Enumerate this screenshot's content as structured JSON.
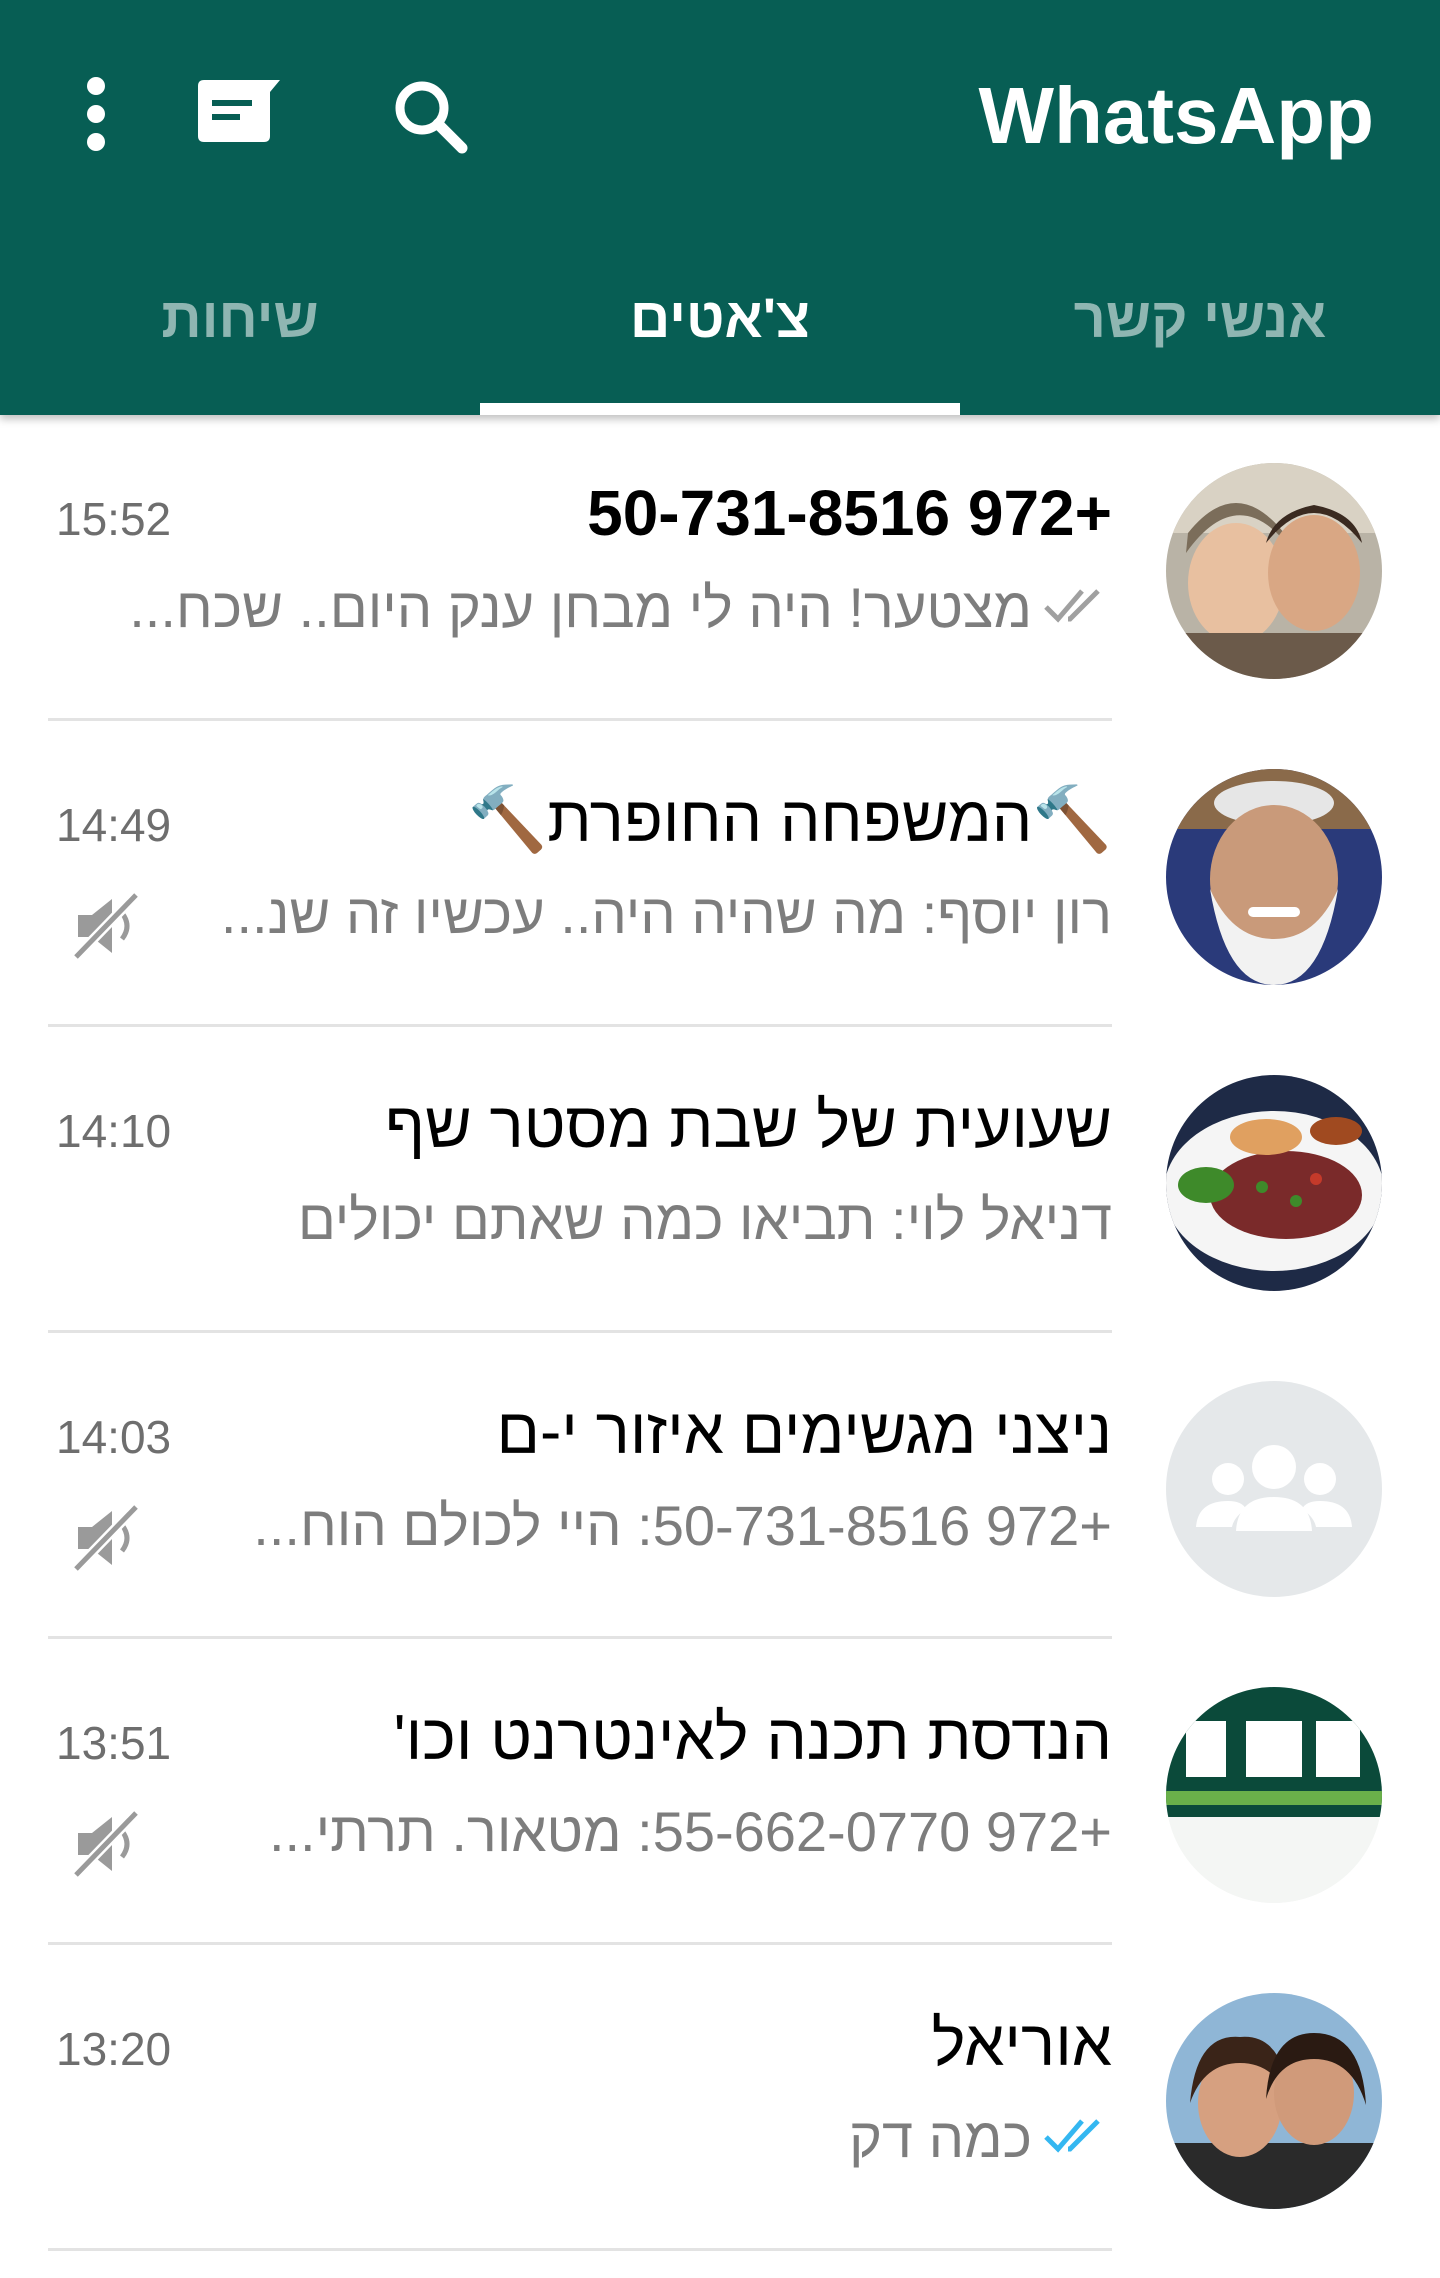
{
  "app": {
    "title": "WhatsApp",
    "colors": {
      "primary": "#075e54",
      "tick_read": "#34b7f1",
      "tick_delivered": "#a0a0a0",
      "muted_icon": "#9a9a9a"
    }
  },
  "toolbar": {
    "icons": [
      "more-vert-icon",
      "new-chat-icon",
      "search-icon"
    ]
  },
  "tabs": [
    {
      "label": "אנשי קשר",
      "active": false
    },
    {
      "label": "צ'אטים",
      "active": true
    },
    {
      "label": "שיחות",
      "active": false
    }
  ],
  "chats": [
    {
      "name": "+972 50-731-8516",
      "time": "15:52",
      "preview": "מצטער! היה לי מבחן ענק היום.. שכח...",
      "status": "delivered",
      "muted": false,
      "bold": true,
      "avatar": "couple-photo"
    },
    {
      "name": "🔨המשפחה החופרת🔨",
      "time": "14:49",
      "preview": "רון יוסף: מה שהיה היה.. עכשיו זה שנ...",
      "status": "none",
      "muted": true,
      "bold": false,
      "avatar": "elder-photo"
    },
    {
      "name": "שעועית של שבת מסטר שף",
      "time": "14:10",
      "preview": "דניאל לוי: תביאו כמה שאתם יכולים",
      "status": "none",
      "muted": false,
      "bold": false,
      "avatar": "food-photo"
    },
    {
      "name": "ניצני מגשימים איזור י-ם",
      "time": "14:03",
      "preview": "+972 50-731-8516: היי לכולם הוח...",
      "status": "none",
      "muted": true,
      "bold": false,
      "avatar": "group-placeholder"
    },
    {
      "name": "הנדסת תכנה לאינטרנט וכו'",
      "time": "13:51",
      "preview": "+972 55-662-0770: מטאור. תרתי...",
      "status": "none",
      "muted": true,
      "bold": false,
      "avatar": "logo-image"
    },
    {
      "name": "אוריאל",
      "time": "13:20",
      "preview": "כמה דק",
      "status": "read",
      "muted": false,
      "bold": false,
      "avatar": "friends-photo"
    }
  ]
}
